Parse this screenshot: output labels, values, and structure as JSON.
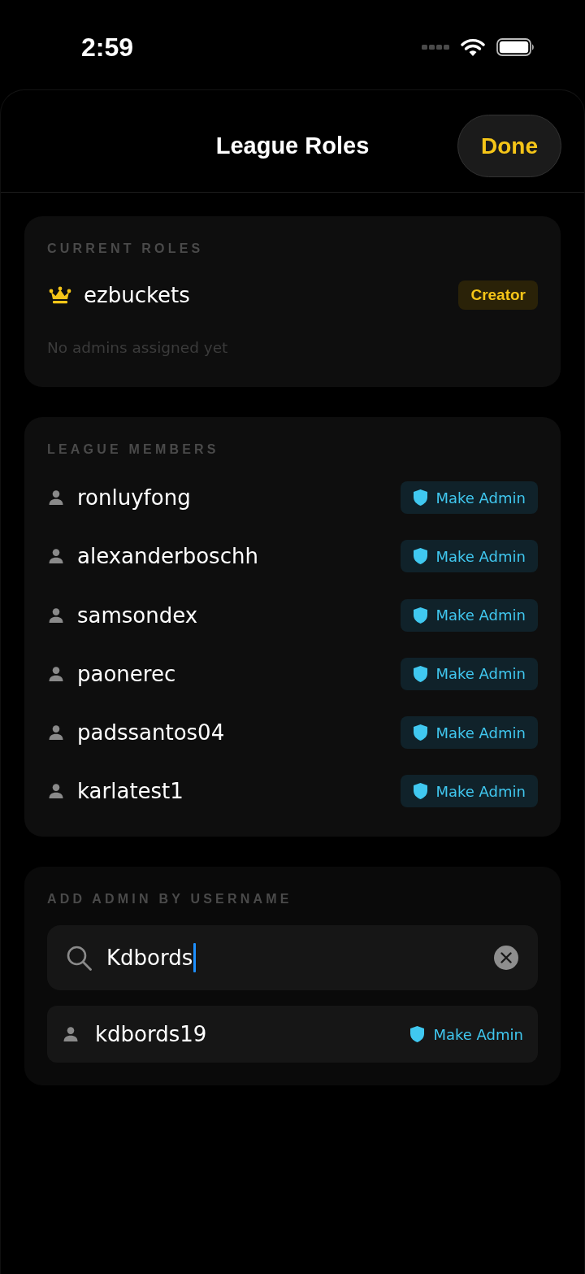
{
  "status_bar": {
    "time": "2:59"
  },
  "header": {
    "title": "League Roles",
    "done_button": "Done"
  },
  "current_roles": {
    "heading": "CURRENT ROLES",
    "members": [
      {
        "username": "ezbuckets",
        "kind": "creator",
        "badge": "Creator"
      }
    ],
    "empty_admins_text": "No admins assigned yet"
  },
  "league_members": {
    "heading": "LEAGUE MEMBERS",
    "members": [
      {
        "username": "ronluyfong",
        "action": "Make Admin"
      },
      {
        "username": "alexanderboschh",
        "action": "Make Admin"
      },
      {
        "username": "samsondex",
        "action": "Make Admin"
      },
      {
        "username": "paonerec",
        "action": "Make Admin"
      },
      {
        "username": "padssantos04",
        "action": "Make Admin"
      },
      {
        "username": "karlatest1",
        "action": "Make Admin"
      }
    ]
  },
  "add_admin": {
    "heading": "ADD ADMIN BY USERNAME",
    "search": {
      "value": "Kdbords",
      "focused": true
    },
    "results": [
      {
        "username": "kdbords19",
        "action": "Make Admin"
      }
    ]
  }
}
